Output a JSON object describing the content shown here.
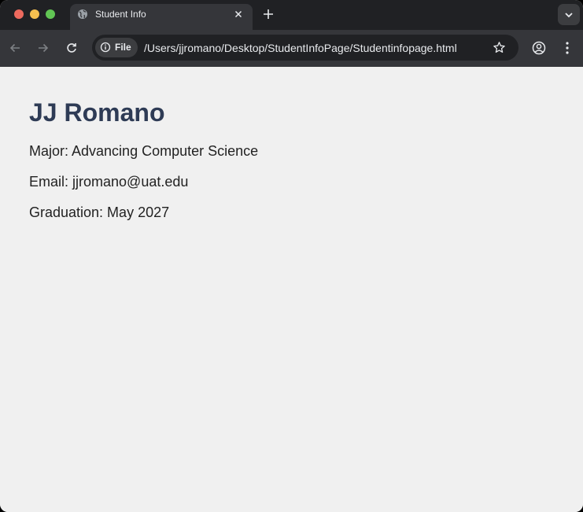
{
  "browser": {
    "tab": {
      "title": "Student Info",
      "icon": "globe-icon"
    },
    "toolbar": {
      "site_chip_label": "File",
      "url": "/Users/jjromano/Desktop/StudentInfoPage/Studentinfopage.html"
    }
  },
  "page": {
    "name": "JJ Romano",
    "major": "Major: Advancing Computer Science",
    "email": "Email: jjromano@uat.edu",
    "graduation": "Graduation: May 2027"
  },
  "colors": {
    "tabstrip_bg": "#202124",
    "toolbar_bg": "#35363a",
    "page_bg": "#f0f0f0",
    "heading": "#2e3b55"
  }
}
